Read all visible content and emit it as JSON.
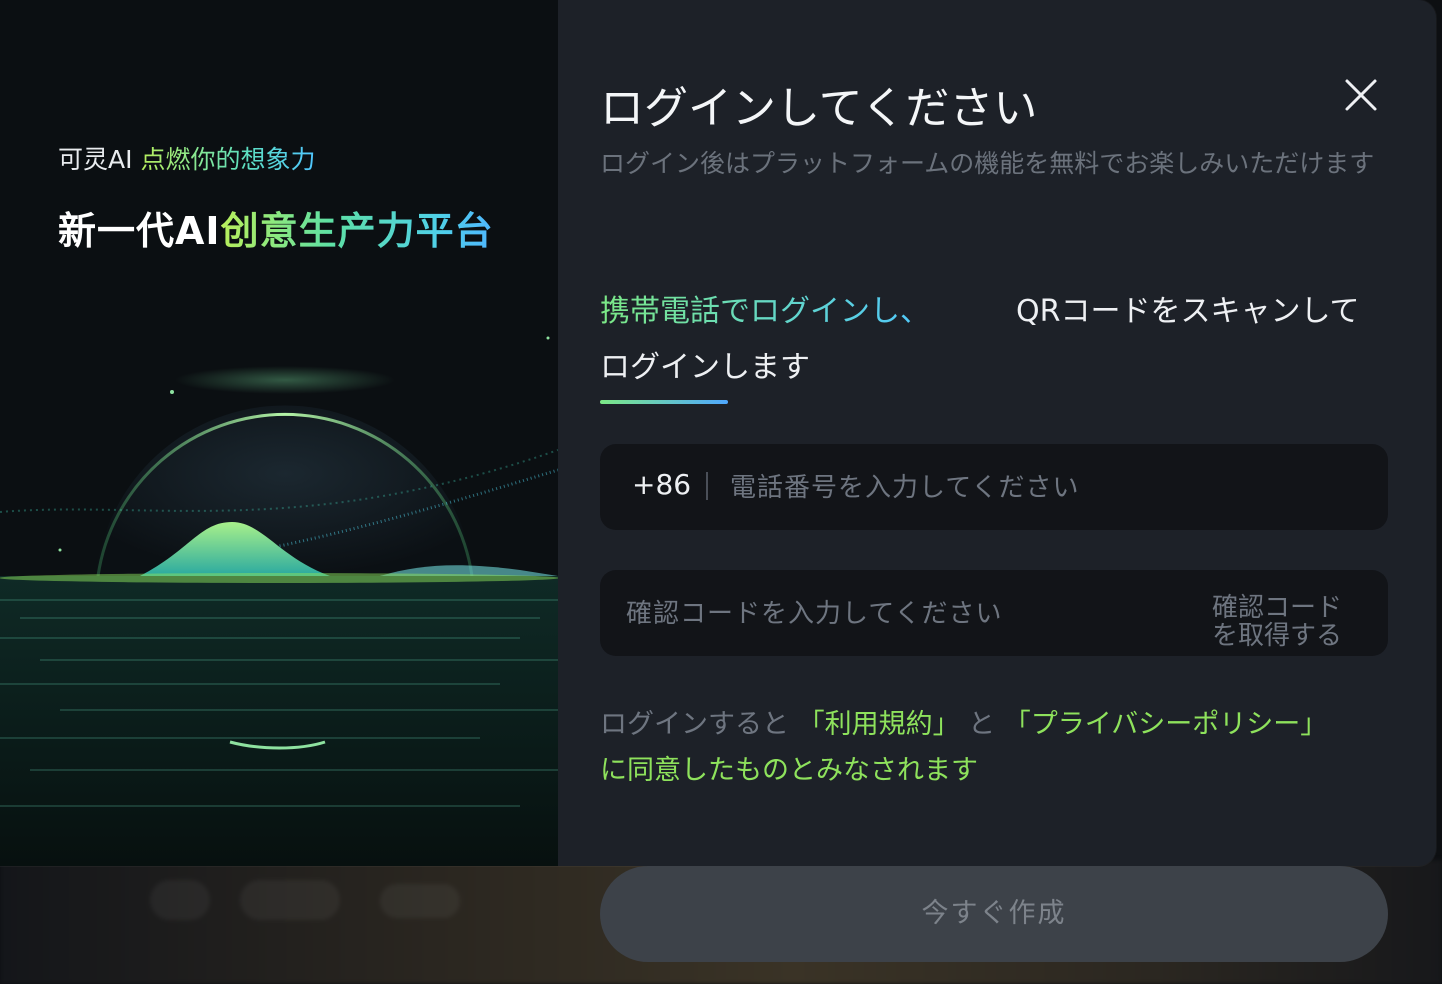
{
  "promo": {
    "brand": "可灵AI",
    "tagline": "点燃你的想象力",
    "headline_a": "新一代AI",
    "headline_b": "创意生产力平台"
  },
  "login": {
    "title": "ログインしてください",
    "subtitle": "ログイン後はプラットフォームの機能を無料でお楽しみいただけます",
    "tabs": {
      "phone": "携帯電話でログインし、",
      "qr_line1": "QRコードをスキャンして",
      "qr_line2": "ログインします"
    },
    "phone_field": {
      "country_code": "+86",
      "placeholder": "電話番号を入力してください"
    },
    "code_field": {
      "placeholder": "確認コードを入力してください",
      "get_code_label": "確認コードを取得する"
    },
    "terms": {
      "prefix": "ログインすると ",
      "terms_link": "「利用規約」",
      "and": " と ",
      "privacy_link": "「プライバシーポリシー」",
      "suffix": "に同意したものとみなされます"
    },
    "submit_label": "今すぐ作成"
  },
  "colors": {
    "accent_green": "#8ee25c",
    "accent_blue": "#4fc8ff",
    "panel_bg": "#1d2128",
    "field_bg": "#121418"
  }
}
